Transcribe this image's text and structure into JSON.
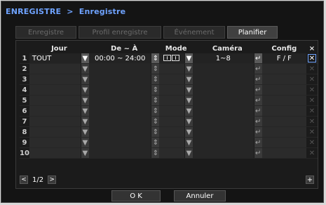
{
  "title": {
    "main": "ENREGISTRE",
    "separator": ">",
    "sub": "Enregistre"
  },
  "tabs": [
    {
      "label": "Enregistre",
      "active": false
    },
    {
      "label": "Profil enregistre",
      "active": false
    },
    {
      "label": "Événement",
      "active": false
    },
    {
      "label": "Planifier",
      "active": true
    }
  ],
  "table": {
    "headers": {
      "day": "Jour",
      "from_to": "De ~ À",
      "mode": "Mode",
      "camera": "Caméra",
      "config": "Config",
      "delete": "×"
    },
    "row1": {
      "num": "1",
      "day": "TOUT",
      "from_to": "00:00 ~ 24:00",
      "camera": "1~8",
      "config": "F / F"
    },
    "row_numbers": [
      "2",
      "3",
      "4",
      "5",
      "6",
      "7",
      "8",
      "9",
      "10"
    ],
    "dropdown_glyph": "▼",
    "stepper_glyph": "⇕",
    "enter_glyph": "↵",
    "delete_glyph": "✕"
  },
  "pager": {
    "prev": "<",
    "page": "1/2",
    "next": ">"
  },
  "add_button": "+",
  "buttons": {
    "ok": "O K",
    "cancel": "Annuler"
  },
  "colors": {
    "accent": "#6fa3ff",
    "background": "#141414"
  }
}
